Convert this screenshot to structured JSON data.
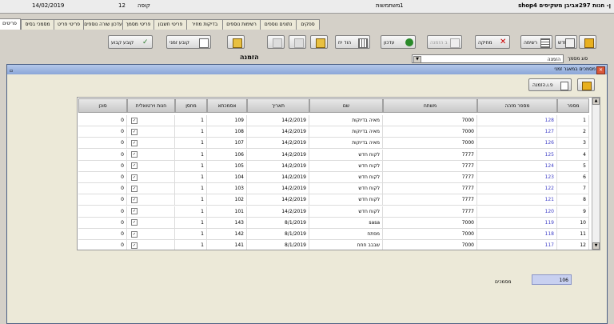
{
  "topbar": {
    "app_title": "shop4 ן- חנות 297אביבן משקיפים",
    "date": "14/02/2019",
    "register_label": "קופה",
    "register_value": "12",
    "user_label": "משתמשות",
    "user_value": "1"
  },
  "tabs": [
    "פריטים",
    "מסמכי בסיס",
    "פריטי פריט",
    "עדכון שורה נוספים",
    "פריטי מסמך",
    "פריטי חשבון",
    "בדיקות מחיר",
    "רשימות נוספים",
    "נתונים נוספים",
    "ספקים"
  ],
  "toolbar": {
    "buttons": [
      {
        "label": "",
        "icon": "exit-icon"
      },
      {
        "label": "חדש",
        "icon": "new-doc-icon"
      },
      {
        "label": "רשימה",
        "icon": "list-icon"
      },
      {
        "label": "מחיקה",
        "icon": "delete-icon"
      },
      {
        "label": "ב הזמנה",
        "icon": "order-icon",
        "disabled": true
      },
      {
        "label": "עדכון",
        "icon": "update-icon"
      },
      {
        "label": "הוד יח",
        "icon": "report-icon"
      },
      {
        "label": "",
        "icon": "arrow-icon"
      },
      {
        "label": "",
        "icon": "arrow-disabled-icon"
      },
      {
        "label": "",
        "icon": "arrow-disabled-icon"
      },
      {
        "label": "",
        "icon": "arrow-icon"
      },
      {
        "label": "קובע זמני",
        "icon": "edit-icon"
      },
      {
        "label": "קובע קבוע",
        "icon": "check-icon"
      }
    ]
  },
  "order": {
    "section_label": "הזמנה",
    "type_label": "סוג מסמך",
    "type_value": "הזמנה"
  },
  "dialog": {
    "title": "מסמכים במאגר זמני",
    "print_button": "פ.ו.הזמנה",
    "columns": [
      "מספר",
      "מספר מזהה",
      "משתח",
      "שם",
      "תאריך",
      "אסמכתא",
      "מחסן",
      "חנות וירטואלית",
      "סוכן"
    ],
    "rows": [
      {
        "num": "1",
        "id": "128",
        "code": "7000",
        "name": "מאיה בדיוקות",
        "date": "14/2/2019",
        "ref": "109",
        "store": "1",
        "virtual": "✓",
        "agent": "0"
      },
      {
        "num": "2",
        "id": "127",
        "code": "7000",
        "name": "מאיה בדיוקות",
        "date": "14/2/2019",
        "ref": "108",
        "store": "1",
        "virtual": "✓",
        "agent": "0"
      },
      {
        "num": "3",
        "id": "126",
        "code": "7000",
        "name": "מאיה בדיוקות",
        "date": "14/2/2019",
        "ref": "107",
        "store": "1",
        "virtual": "✓",
        "agent": "0"
      },
      {
        "num": "4",
        "id": "125",
        "code": "7777",
        "name": "לקוח חדש",
        "date": "14/2/2019",
        "ref": "106",
        "store": "1",
        "virtual": "✓",
        "agent": "0"
      },
      {
        "num": "5",
        "id": "124",
        "code": "7777",
        "name": "לקוח חדש",
        "date": "14/2/2019",
        "ref": "105",
        "store": "1",
        "virtual": "✓",
        "agent": "0"
      },
      {
        "num": "6",
        "id": "123",
        "code": "7777",
        "name": "לקוח חדש",
        "date": "14/2/2019",
        "ref": "104",
        "store": "1",
        "virtual": "✓",
        "agent": "0"
      },
      {
        "num": "7",
        "id": "122",
        "code": "7777",
        "name": "לקוח חדש",
        "date": "14/2/2019",
        "ref": "103",
        "store": "1",
        "virtual": "✓",
        "agent": "0"
      },
      {
        "num": "8",
        "id": "121",
        "code": "7777",
        "name": "לקוח חדש",
        "date": "14/2/2019",
        "ref": "102",
        "store": "1",
        "virtual": "✓",
        "agent": "0"
      },
      {
        "num": "9",
        "id": "120",
        "code": "7777",
        "name": "לקוח חדש",
        "date": "14/2/2019",
        "ref": "101",
        "store": "1",
        "virtual": "✓",
        "agent": "0"
      },
      {
        "num": "10",
        "id": "119",
        "code": "7000",
        "name": "sasa",
        "date": "8/1/2019",
        "ref": "143",
        "store": "1",
        "virtual": "✓",
        "agent": "0"
      },
      {
        "num": "11",
        "id": "118",
        "code": "7000",
        "name": "מפתח",
        "date": "8/1/2019",
        "ref": "142",
        "store": "1",
        "virtual": "✓",
        "agent": "0"
      },
      {
        "num": "12",
        "id": "117",
        "code": "7000",
        "name": "שבבב חחח",
        "date": "8/1/2019",
        "ref": "141",
        "store": "1",
        "virtual": "✓",
        "agent": "0"
      }
    ],
    "count_label": "מסמכים",
    "count_value": "106"
  }
}
